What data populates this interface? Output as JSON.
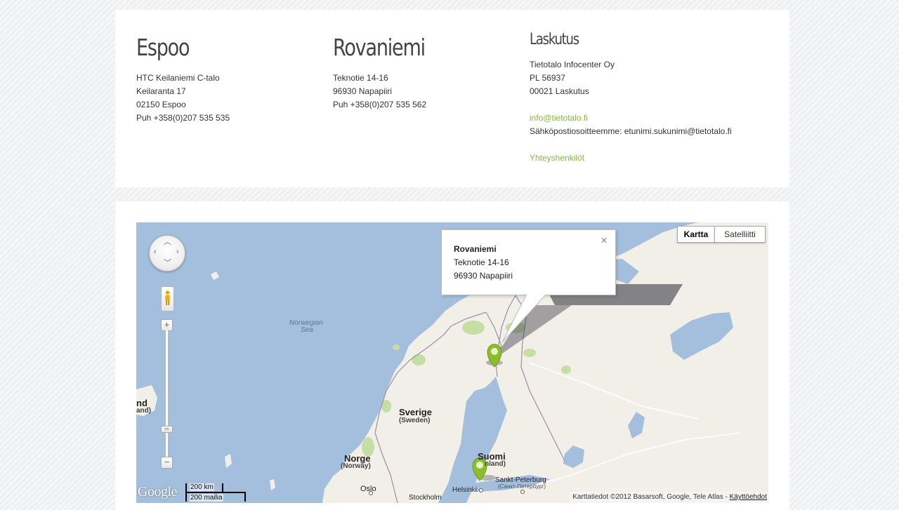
{
  "contacts": {
    "espoo": {
      "title": "Espoo",
      "lines": [
        "HTC Keilaniemi C-talo",
        "Keilaranta 17",
        "02150 Espoo",
        "Puh +358(0)207 535 535"
      ]
    },
    "rovaniemi": {
      "title": "Rovaniemi",
      "lines": [
        "Teknotie 14-16",
        "96930 Napapiiri",
        "Puh +358(0)207 535 562"
      ]
    },
    "laskutus": {
      "title": "Laskutus",
      "lines": [
        "Tietotalo Infocenter Oy",
        "PL 56937",
        "00021 Laskutus"
      ],
      "email_link": "info@tietotalo.fi",
      "email_note": "Sähköpostiosoitteemme: etunimi.sukunimi@tietotalo.fi",
      "contacts_link": "Yhteyshenkilöt"
    }
  },
  "map": {
    "type_buttons": {
      "map": "Kartta",
      "satellite": "Satelliitti"
    },
    "selected_type": "Kartta",
    "info_window": {
      "title": "Rovaniemi",
      "lines": [
        "Teknotie 14-16",
        "96930 Napapiiri"
      ],
      "close_glyph": "×"
    },
    "labels": {
      "sea_line1": "Norwegian",
      "sea_line2": "Sea",
      "sverige": "Sverige",
      "sverige_en": "(Sweden)",
      "norge": "Norge",
      "norge_en": "(Norway)",
      "suomi": "Suomi",
      "suomi_en": "nland)",
      "iceland": "nd",
      "iceland_en": "and)",
      "oslo": "Oslo",
      "helsinki": "Helsinki",
      "stockholm": "Stockholm",
      "spb": "Sankt-Peterburg",
      "spb_ru": "(Санкт-Петербург)"
    },
    "scale": {
      "km": "200 km",
      "miles": "200 mailia"
    },
    "logo": "Google",
    "attribution": "Karttatiedot ©2012 Basarsoft, Google, Tele Atlas - ",
    "terms_link": "Käyttöehdot",
    "zoom": {
      "in": "+",
      "out": "−"
    },
    "colors": {
      "water": "#a4bfdd",
      "land": "#f2efe9",
      "forest": "#c6dea3",
      "marker": "#8cbd2a"
    }
  }
}
